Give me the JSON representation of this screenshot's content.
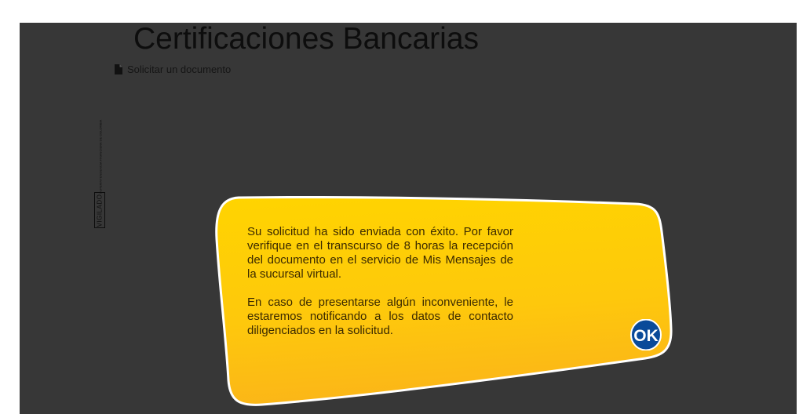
{
  "page": {
    "title": "Certificaciones Bancarias",
    "doc_link_label": "Solicitar un documento",
    "doc_icon": "document-icon"
  },
  "vigilado": {
    "badge_text": "VIGILADO",
    "small_text": "SUPERINTENDENCIA FINANCIERA DE COLOMBIA"
  },
  "modal": {
    "paragraph_1": "Su solicitud ha sido enviada con éxito. Por favor verifique en el transcurso de 8 horas la recepción del documento en el servicio de Mis Mensajes de la sucursal virtual.",
    "paragraph_2": "En caso de presentarse algún inconveniente, le estaremos notificando a los datos de contacto diligenciados en la solicitud.",
    "ok_label": "OK"
  },
  "colors": {
    "overlay": "#373737",
    "modal_top": "#ffd100",
    "modal_bottom": "#fbb716",
    "modal_border": "#ffffff",
    "ok_fill": "#0a4a99",
    "ok_text": "#ffffff"
  }
}
